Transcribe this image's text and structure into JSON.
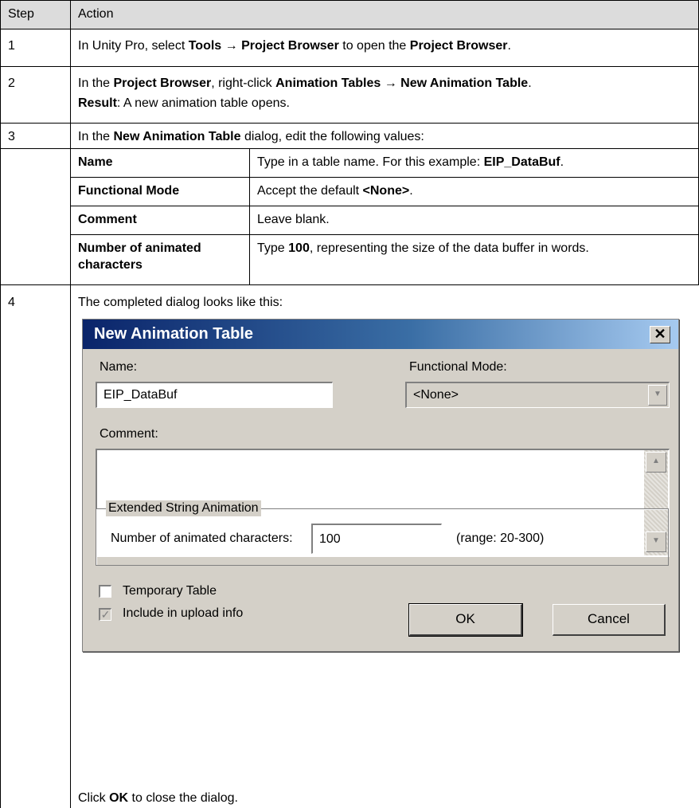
{
  "table": {
    "headers": {
      "step": "Step",
      "action": "Action"
    },
    "rows": [
      {
        "step": "1",
        "parts": [
          "In Unity Pro, select ",
          "Tools",
          " → ",
          "Project Browser",
          " to open the ",
          "Project Browser",
          "."
        ]
      },
      {
        "step": "2",
        "parts": [
          "In the ",
          "Project Browser",
          ", right-click ",
          "Animation Tables",
          " → ",
          "New Animation Table",
          "."
        ],
        "result_label": "Result",
        "result_text": ": A new animation table opens."
      },
      {
        "step": "3",
        "parts": [
          "In the ",
          "New Animation Table",
          " dialog, edit the following values:"
        ],
        "subtable": [
          {
            "field": "Name",
            "desc_parts": [
              "Type in a table name. For this example: ",
              "EIP_DataBuf",
              "."
            ]
          },
          {
            "field": "Functional Mode",
            "desc_parts": [
              "Accept the default ",
              "<None>",
              "."
            ]
          },
          {
            "field": "Comment",
            "desc_parts": [
              "Leave blank."
            ]
          },
          {
            "field_line1": "Number of animated",
            "field_line2": "characters",
            "desc_parts": [
              "Type ",
              "100",
              ", representing the size of the data buffer in words."
            ]
          }
        ]
      },
      {
        "step": "4",
        "intro": "The completed dialog looks like this:",
        "closing_parts": [
          "Click ",
          "OK",
          " to close the dialog."
        ]
      }
    ]
  },
  "dialog": {
    "title": "New Animation Table",
    "close_glyph": "✕",
    "name_label": "Name:",
    "name_value": "EIP_DataBuf",
    "mode_label": "Functional Mode:",
    "mode_value": "<None>",
    "comment_label": "Comment:",
    "comment_value": "",
    "group_title": "Extended String Animation",
    "chars_label": "Number of animated characters:",
    "chars_value": "100",
    "range_text": "(range: 20-300)",
    "temporary_label": "Temporary Table",
    "temporary_checked": false,
    "upload_label": "Include in upload info",
    "upload_checked": true,
    "ok_label": "OK",
    "cancel_label": "Cancel"
  }
}
